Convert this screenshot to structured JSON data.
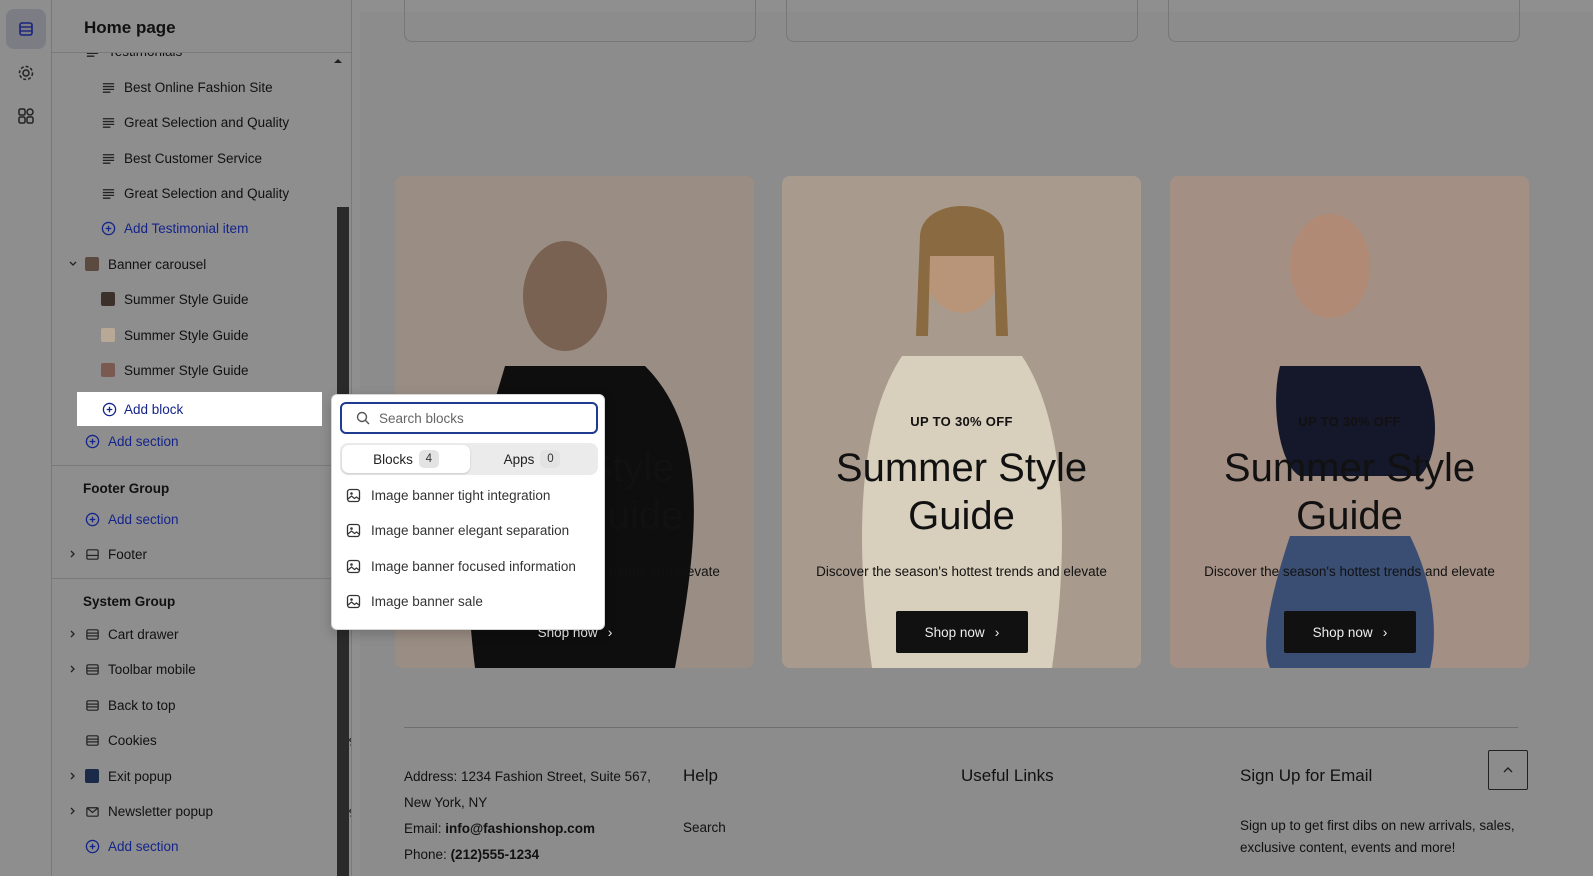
{
  "sidebar": {
    "title": "Home page",
    "partial_item": "Testimonials",
    "testimonial_items": [
      "Best Online Fashion Site",
      "Great Selection and Quality",
      "Best Customer Service",
      "Great Selection and Quality"
    ],
    "add_testimonial": "Add Testimonial item",
    "banner_section": "Banner carousel",
    "banner_items": [
      "Summer Style Guide",
      "Summer Style Guide",
      "Summer Style Guide"
    ],
    "add_block": "Add block",
    "add_section": "Add section",
    "footer_group": "Footer Group",
    "footer_add_section": "Add section",
    "footer": "Footer",
    "system_group": "System Group",
    "system_items": [
      "Cart drawer",
      "Toolbar mobile",
      "Back to top",
      "Cookies",
      "Exit popup",
      "Newsletter popup"
    ],
    "system_add_section": "Add section"
  },
  "popover": {
    "search_placeholder": "Search blocks",
    "tab_blocks": "Blocks",
    "tab_blocks_count": "4",
    "tab_apps": "Apps",
    "tab_apps_count": "0",
    "items": [
      "Image banner tight integration",
      "Image banner elegant separation",
      "Image banner focused information",
      "Image banner sale"
    ]
  },
  "preview": {
    "banners": [
      {
        "kicker": "",
        "title": "Style\nGuide",
        "desc": "Discover the season's hottest trends and elevate",
        "button": "Shop now",
        "bg": "#9a8e84"
      },
      {
        "kicker": "UP TO 30% OFF",
        "title": "Summer Style\nGuide",
        "desc": "Discover the season's hottest trends and elevate",
        "button": "Shop now",
        "bg": "#a89b8e"
      },
      {
        "kicker": "UP TO 30% OFF",
        "title": "Summer Style\nGuide",
        "desc": "Discover the season's hottest trends and elevate",
        "button": "Shop now",
        "bg": "#a48f84"
      }
    ],
    "footer": {
      "address": "Address: 1234 Fashion Street, Suite 567, New York, NY",
      "email_label": "Email:",
      "email": "info@fashionshop.com",
      "phone_label": "Phone:",
      "phone": "(212)555-1234",
      "help_title": "Help",
      "help_link": "Search",
      "useful_title": "Useful Links",
      "signup_title": "Sign Up for Email",
      "signup_text": "Sign up to get first dibs on new arrivals, sales, exclusive content, events and more!"
    }
  },
  "colors": {
    "accent": "#14248a",
    "overlay": "#8e8e8e",
    "focus": "#1f3a8f"
  }
}
